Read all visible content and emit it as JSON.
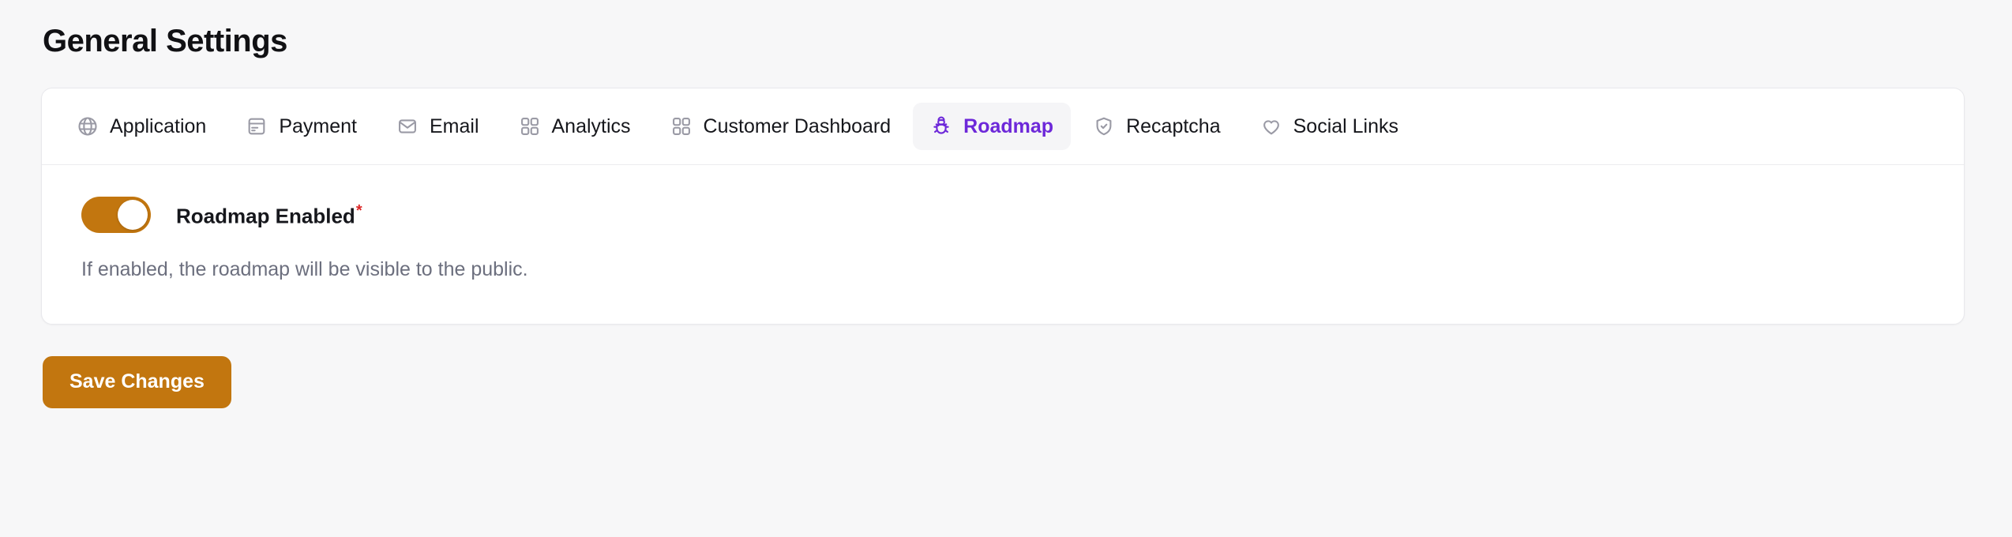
{
  "page": {
    "title": "General Settings",
    "background_color": "#f7f7f8"
  },
  "tabs": {
    "active_index": 5,
    "items": [
      {
        "label": "Application",
        "icon": "globe-icon",
        "active": false
      },
      {
        "label": "Payment",
        "icon": "credit-card-icon",
        "active": false
      },
      {
        "label": "Email",
        "icon": "envelope-icon",
        "active": false
      },
      {
        "label": "Analytics",
        "icon": "grid-icon",
        "active": false
      },
      {
        "label": "Customer Dashboard",
        "icon": "grid-icon",
        "active": false
      },
      {
        "label": "Roadmap",
        "icon": "bug-icon",
        "active": true
      },
      {
        "label": "Recaptcha",
        "icon": "shield-check-icon",
        "active": false
      },
      {
        "label": "Social Links",
        "icon": "heart-icon",
        "active": false
      }
    ],
    "active_color": "#6d28d9",
    "inactive_color": "#16171c",
    "icon_color": "#9a9aa5",
    "active_background": "#f5f5f7"
  },
  "settings": {
    "roadmap_enabled": {
      "label": "Roadmap Enabled",
      "required_marker": "*",
      "checked": true,
      "on_color": "#c2760f",
      "help_text": "If enabled, the roadmap will be visible to the public."
    }
  },
  "actions": {
    "save_label": "Save Changes",
    "save_color": "#c2760f"
  }
}
